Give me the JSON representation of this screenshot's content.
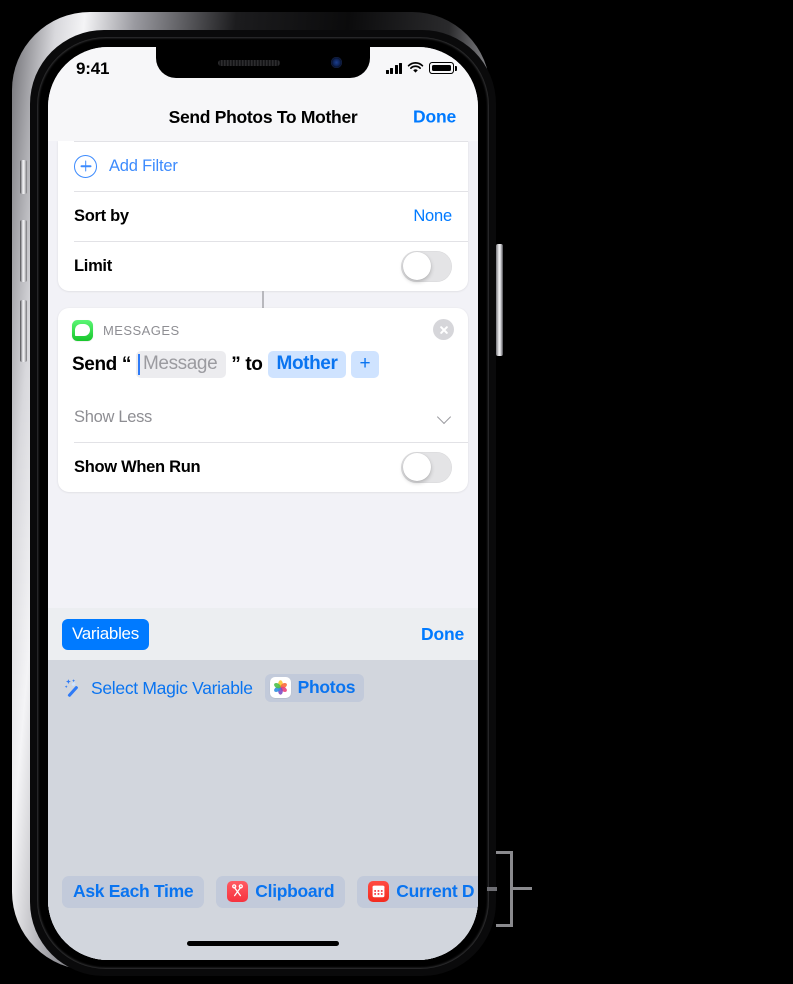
{
  "status_bar": {
    "time": "9:41",
    "cellular_icon": "signal-bars-icon",
    "wifi_icon": "wifi-icon",
    "battery_icon": "battery-icon"
  },
  "nav": {
    "title": "Send Photos To Mother",
    "done_label": "Done"
  },
  "top_card": {
    "add_filter": {
      "label": "Add Filter",
      "icon": "plus-circle-icon"
    },
    "sort_by": {
      "label": "Sort by",
      "value": "None"
    },
    "limit": {
      "label": "Limit",
      "toggle_state": "off"
    }
  },
  "messages_card": {
    "app_name": "MESSAGES",
    "app_icon": "messages-app-icon",
    "close_icon": "close-circle-icon",
    "action": {
      "word_send": "Send",
      "open_quote": "“",
      "message_placeholder": "Message",
      "close_quote": "”",
      "word_to": "to",
      "recipient_variable": "Mother",
      "add_recipient_label": "+"
    },
    "show_less": {
      "label": "Show Less",
      "icon": "chevron-down-icon"
    },
    "show_when_run": {
      "label": "Show When Run",
      "toggle_state": "off"
    }
  },
  "variables_toolbar": {
    "variables_label": "Variables",
    "done_label": "Done"
  },
  "variables_panel": {
    "magic_variable": {
      "wand_icon": "magic-wand-icon",
      "label": "Select Magic Variable",
      "chip_label": "Photos",
      "chip_icon": "photos-app-icon"
    },
    "suggestions": [
      {
        "label": "Ask Each Time",
        "icon": null
      },
      {
        "label": "Clipboard",
        "icon": "clipboard-scissors-icon"
      },
      {
        "label": "Current D",
        "icon": "calendar-icon"
      }
    ]
  },
  "colors": {
    "accent_blue": "#007aff",
    "link_blue": "#0a74f0",
    "variable_chip": "#cfe3ff",
    "panel_background": "#d2d6dd",
    "messages_green": "#18c62c",
    "clipboard_red": "#f6333f"
  }
}
